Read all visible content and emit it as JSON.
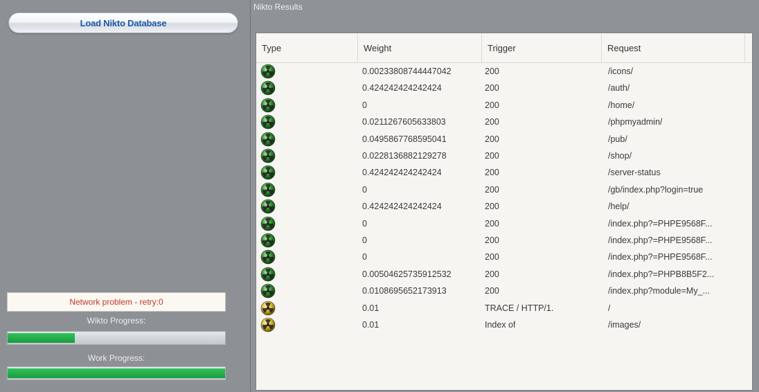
{
  "left": {
    "load_button": "Load Nikto Database",
    "status": "Network problem - retry:0",
    "wikto_label": "Wikto Progress:",
    "work_label": "Work Progress:",
    "wikto_progress": 0.31,
    "work_progress": 1.0
  },
  "results": {
    "title": "Nikto Results",
    "columns": [
      "Type",
      "Weight",
      "Trigger",
      "Request"
    ],
    "rows": [
      {
        "type": "green-radiation-icon",
        "weight": "0.00233808744447042",
        "trigger": "200",
        "request": "/icons/"
      },
      {
        "type": "green-radiation-icon",
        "weight": "0.424242424242424",
        "trigger": "200",
        "request": "/auth/"
      },
      {
        "type": "green-radiation-icon",
        "weight": "0",
        "trigger": "200",
        "request": "/home/"
      },
      {
        "type": "green-radiation-icon",
        "weight": "0.0211267605633803",
        "trigger": "200",
        "request": "/phpmyadmin/"
      },
      {
        "type": "green-radiation-icon",
        "weight": "0.0495867768595041",
        "trigger": "200",
        "request": "/pub/"
      },
      {
        "type": "green-radiation-icon",
        "weight": "0.0228136882129278",
        "trigger": "200",
        "request": "/shop/"
      },
      {
        "type": "green-radiation-icon",
        "weight": "0.424242424242424",
        "trigger": "200",
        "request": "/server-status"
      },
      {
        "type": "green-radiation-icon",
        "weight": "0",
        "trigger": "200",
        "request": "/gb/index.php?login=true"
      },
      {
        "type": "green-radiation-icon",
        "weight": "0.424242424242424",
        "trigger": "200",
        "request": "/help/"
      },
      {
        "type": "green-radiation-icon",
        "weight": "0",
        "trigger": "200",
        "request": "/index.php?=PHPE9568F..."
      },
      {
        "type": "green-radiation-icon",
        "weight": "0",
        "trigger": "200",
        "request": "/index.php?=PHPE9568F..."
      },
      {
        "type": "green-radiation-icon",
        "weight": "0",
        "trigger": "200",
        "request": "/index.php?=PHPE9568F..."
      },
      {
        "type": "green-radiation-icon",
        "weight": "0.00504625735912532",
        "trigger": "200",
        "request": "/index.php?=PHPB8B5F2..."
      },
      {
        "type": "green-radiation-icon",
        "weight": "0.0108695652173913",
        "trigger": "200",
        "request": "/index.php?module=My_..."
      },
      {
        "type": "yellow-radiation-icon",
        "weight": "0.01",
        "trigger": "TRACE / HTTP/1.",
        "request": "/"
      },
      {
        "type": "yellow-radiation-icon",
        "weight": "0.01",
        "trigger": "Index of",
        "request": "/images/"
      }
    ]
  },
  "colors": {
    "green_icon": "#2c8a2a",
    "yellow_icon": "#d8b52a",
    "status_text": "#c0392b",
    "button_text": "#1e5aa8",
    "progress_fill": "#1fa745"
  }
}
